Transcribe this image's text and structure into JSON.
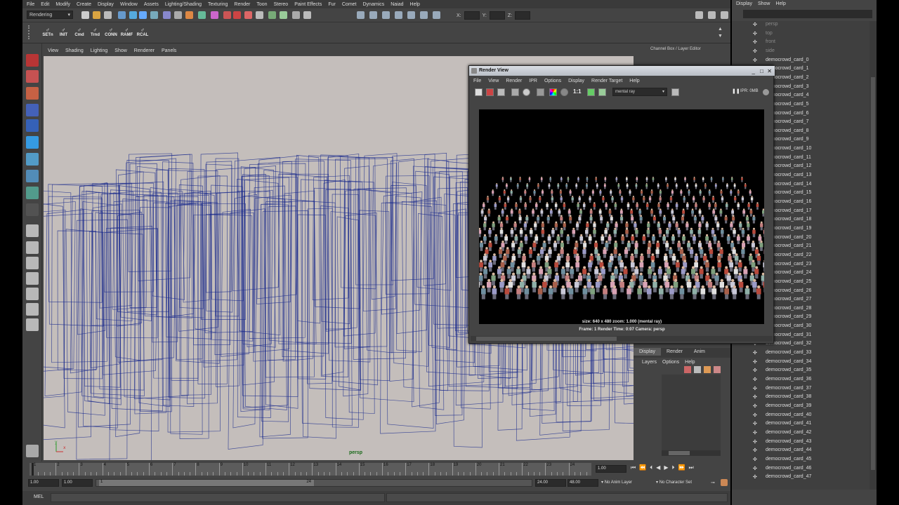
{
  "main_menu": [
    "File",
    "Edit",
    "Modify",
    "Create",
    "Display",
    "Window",
    "Assets",
    "Lighting/Shading",
    "Texturing",
    "Render",
    "Toon",
    "Stereo",
    "Paint Effects",
    "Fur",
    "Comet",
    "Dynamics",
    "Naiad",
    "Help"
  ],
  "status_line": {
    "mode": "Rendering",
    "coord_labels": [
      "X:",
      "Y:",
      "Z:"
    ]
  },
  "shelf_buttons": [
    "SETn",
    "INIT",
    "Cmd",
    "Trnd",
    "CONN",
    "RAMF",
    "RCAL"
  ],
  "viewport": {
    "menu": [
      "View",
      "Shading",
      "Lighting",
      "Show",
      "Renderer",
      "Panels"
    ],
    "camera_label": "persp"
  },
  "channel_box": {
    "header": "Channel Box / Layer Editor",
    "tabs": [
      "Display",
      "Render",
      "Anim"
    ],
    "layer_menu": [
      "Layers",
      "Options",
      "Help"
    ]
  },
  "render_view": {
    "title": "Render View",
    "menu": [
      "File",
      "View",
      "Render",
      "IPR",
      "Options",
      "Display",
      "Render Target",
      "Help"
    ],
    "ratio_label": "1:1",
    "renderer": "mental ray",
    "ipr_label": "IPR: 0MB",
    "info_line1": "size: 640 x 480 zoom: 1.000      (mental ray)",
    "info_line2": "Frame: 1      Render Time: 0:07      Camera: persp"
  },
  "timeline": {
    "ticks": [
      "1",
      "2",
      "3",
      "4",
      "5",
      "6",
      "7",
      "8",
      "9",
      "10",
      "11",
      "12",
      "13",
      "14",
      "15",
      "16",
      "17",
      "18",
      "19",
      "20",
      "21",
      "22",
      "23",
      "24"
    ],
    "current_frame": "1.00"
  },
  "range_slider": {
    "start_time": "1.00",
    "playback_start": "1.00",
    "range_start_label": "1",
    "range_end_label": "24",
    "playback_end": "24.00",
    "end_time": "48.00",
    "anim_layer": "No Anim Layer",
    "character_set": "No Character Set"
  },
  "command_line": {
    "label": "MEL"
  },
  "outliner": {
    "menu": [
      "Display",
      "Show",
      "Help"
    ],
    "cameras": [
      "persp",
      "top",
      "front",
      "side"
    ],
    "items": [
      "democrowd_card_0",
      "democrowd_card_1",
      "democrowd_card_2",
      "democrowd_card_3",
      "democrowd_card_4",
      "democrowd_card_5",
      "democrowd_card_6",
      "democrowd_card_7",
      "democrowd_card_8",
      "democrowd_card_9",
      "democrowd_card_10",
      "democrowd_card_11",
      "democrowd_card_12",
      "democrowd_card_13",
      "democrowd_card_14",
      "democrowd_card_15",
      "democrowd_card_16",
      "democrowd_card_17",
      "democrowd_card_18",
      "democrowd_card_19",
      "democrowd_card_20",
      "democrowd_card_21",
      "democrowd_card_22",
      "democrowd_card_23",
      "democrowd_card_24",
      "democrowd_card_25",
      "democrowd_card_26",
      "democrowd_card_27",
      "democrowd_card_28",
      "democrowd_card_29",
      "democrowd_card_30",
      "democrowd_card_31",
      "democrowd_card_32",
      "democrowd_card_33",
      "democrowd_card_34",
      "democrowd_card_35",
      "democrowd_card_36",
      "democrowd_card_37",
      "democrowd_card_38",
      "democrowd_card_39",
      "democrowd_card_40",
      "democrowd_card_41",
      "democrowd_card_42",
      "democrowd_card_43",
      "democrowd_card_44",
      "democrowd_card_45",
      "democrowd_card_46",
      "democrowd_card_47"
    ]
  },
  "colors": {
    "wireframe": "#1a2a8c",
    "viewport_bg": "#c4bebb",
    "ui_bg": "#444444"
  }
}
